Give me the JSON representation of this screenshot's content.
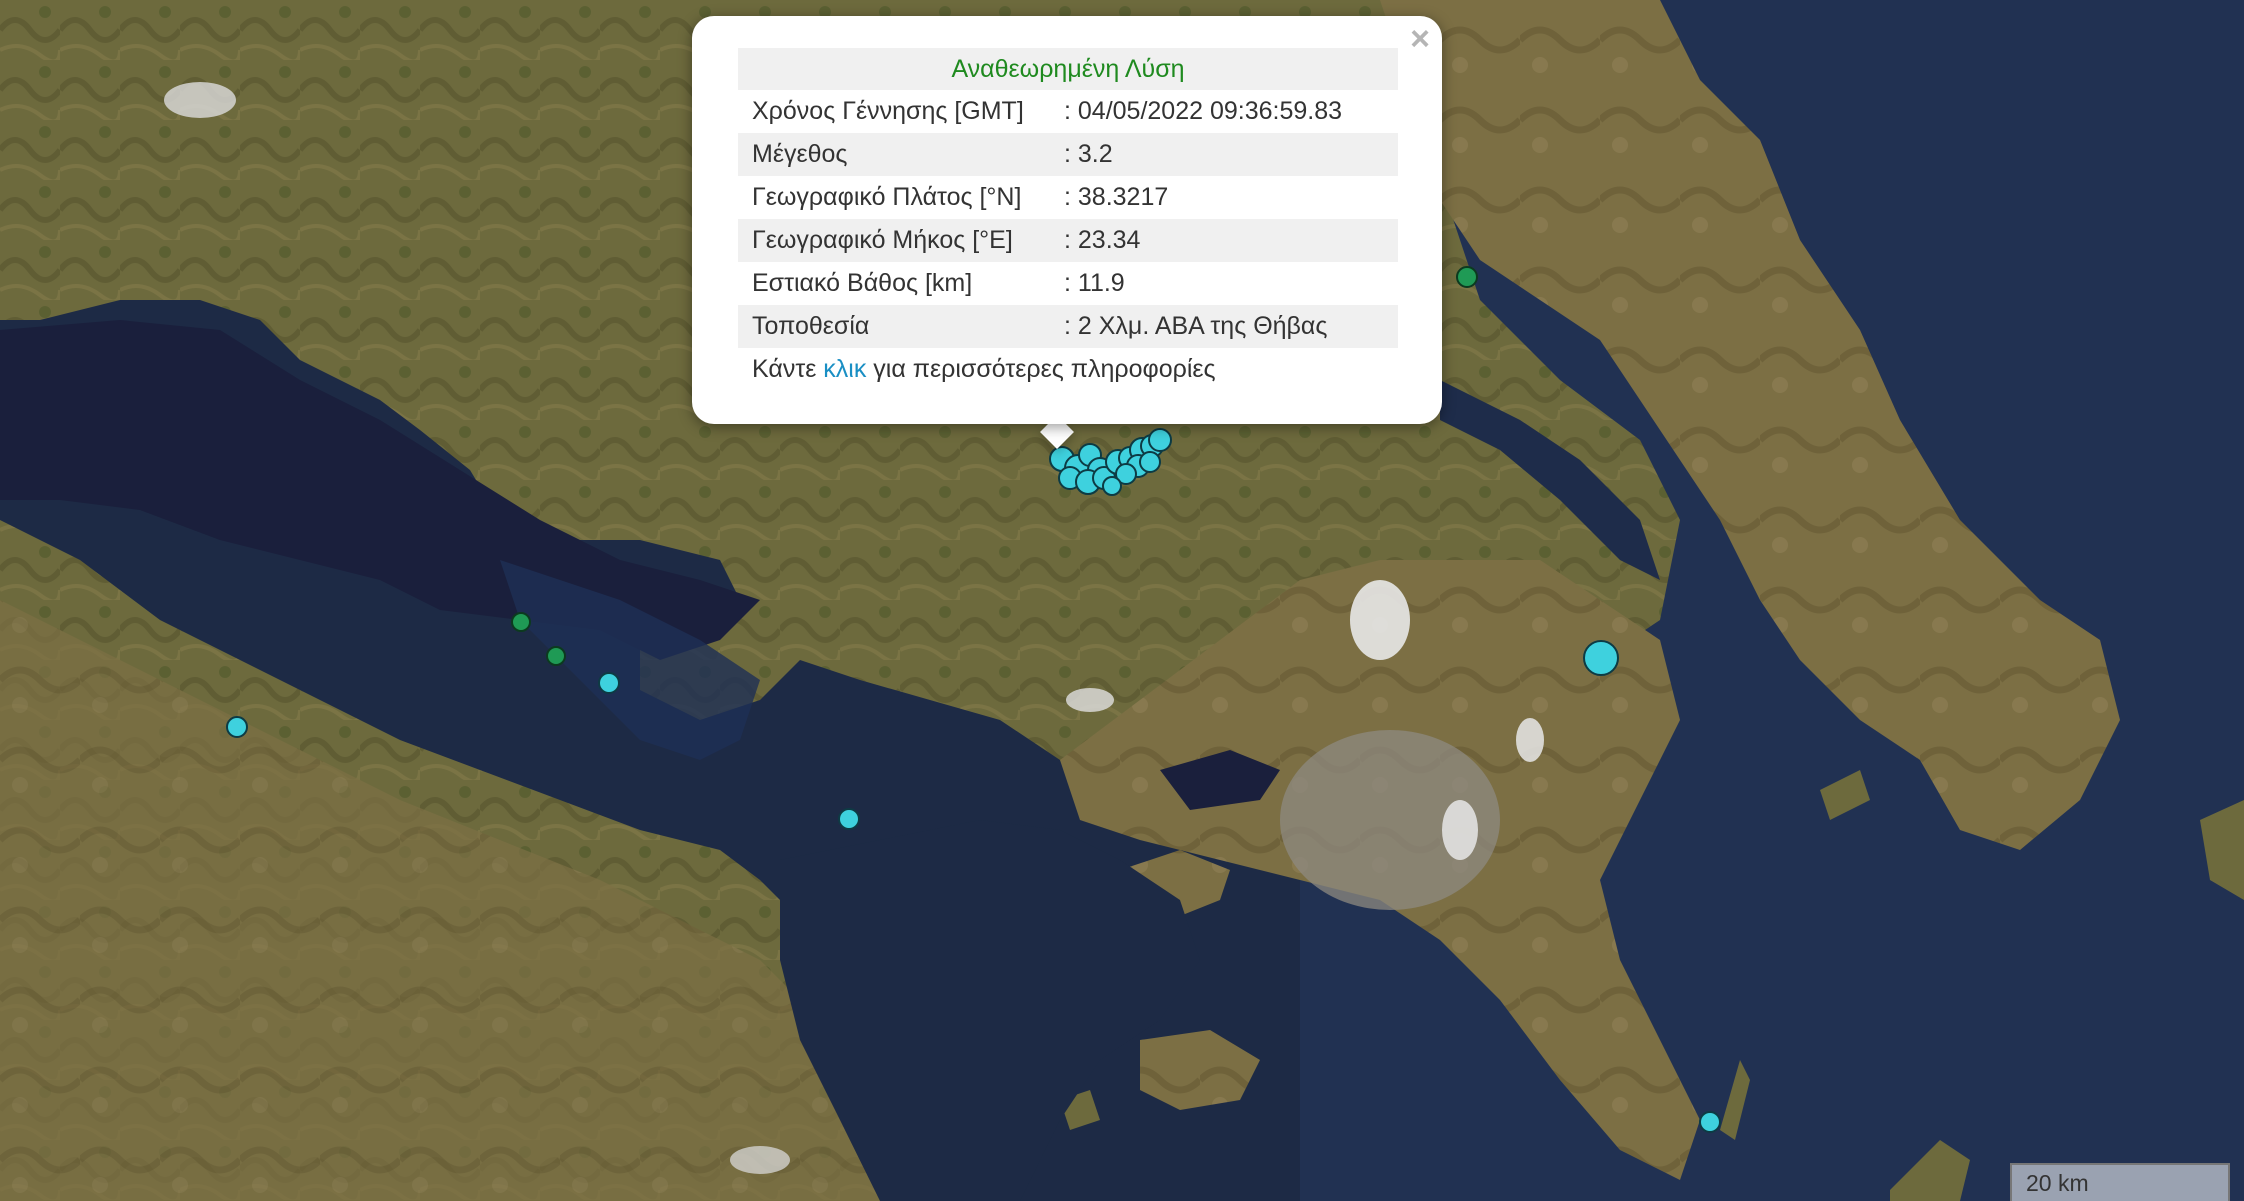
{
  "popup": {
    "title": "Αναθεωρημένη Λύση",
    "close_glyph": "×",
    "rows": [
      {
        "label": "Χρόνος Γέννησης [GMT]",
        "value": ": 04/05/2022 09:36:59.83"
      },
      {
        "label": "Μέγεθος",
        "value": ": 3.2"
      },
      {
        "label": "Γεωγραφικό Πλάτος [°N]",
        "value": ": 38.3217"
      },
      {
        "label": "Γεωγραφικό Μήκος [°E]",
        "value": ": 23.34"
      },
      {
        "label": "Εστιακό Βάθος [km]",
        "value": ": 11.9"
      },
      {
        "label": "Τοποθεσία",
        "value": ": 2 Χλμ. ΑΒΑ της Θήβας"
      }
    ],
    "footer_prefix": "Κάντε ",
    "footer_link": "κλικ",
    "footer_suffix": " για περισσότερες πληροφορίες"
  },
  "scale_bar": {
    "label": "20 km"
  },
  "colors": {
    "recent_marker": "#3ed1de",
    "older_marker": "#1f9a55",
    "sea": "#1d2a45",
    "land": "#6b6a3c",
    "popup_title": "#1f8a1f",
    "link": "#1a8fc4"
  }
}
